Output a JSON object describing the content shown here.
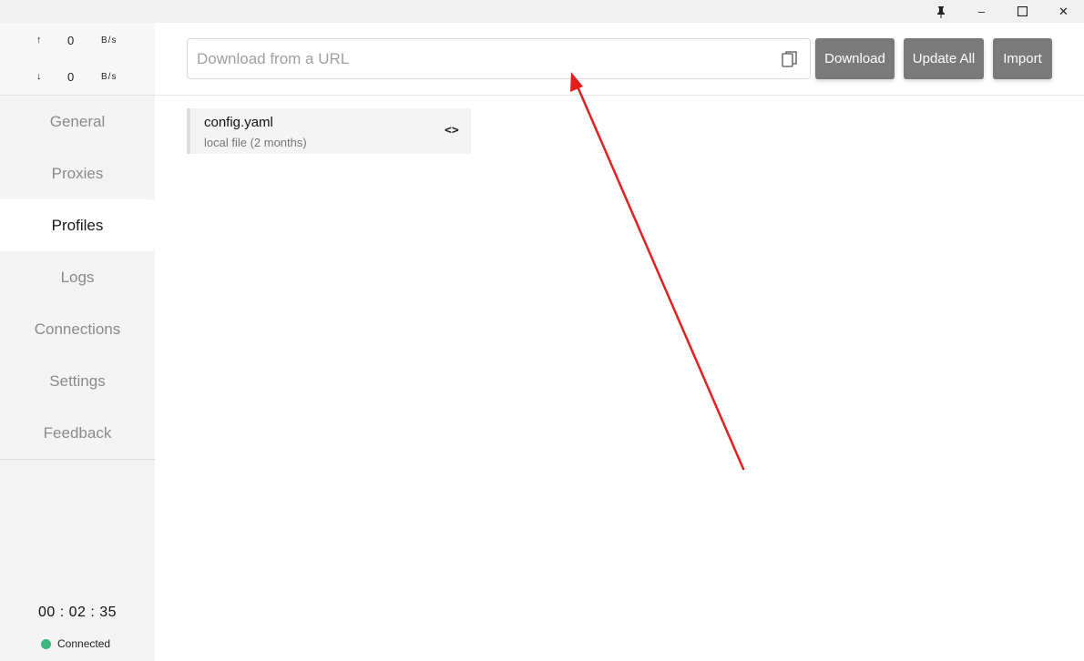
{
  "window": {
    "pin_icon": "pin-icon",
    "minimize_glyph": "–",
    "maximize_glyph": "☐",
    "close_glyph": "✕"
  },
  "traffic": {
    "up_arrow": "↑",
    "up_value": "0",
    "up_unit": "B/s",
    "down_arrow": "↓",
    "down_value": "0",
    "down_unit": "B/s"
  },
  "sidebar": {
    "items": [
      {
        "label": "General"
      },
      {
        "label": "Proxies"
      },
      {
        "label": "Profiles"
      },
      {
        "label": "Logs"
      },
      {
        "label": "Connections"
      },
      {
        "label": "Settings"
      },
      {
        "label": "Feedback"
      }
    ],
    "active": "Profiles",
    "clock": "00 : 02 : 35",
    "status": "Connected",
    "status_color": "#3bb77e"
  },
  "toolbar": {
    "url_placeholder": "Download from a URL",
    "url_value": "",
    "download_label": "Download",
    "update_all_label": "Update All",
    "import_label": "Import",
    "button_color": "#7a7a7a"
  },
  "profiles": [
    {
      "name": "config.yaml",
      "subtitle": "local file (2 months)",
      "action_glyph": "<>"
    }
  ],
  "annotation_color": "#e41e1e"
}
